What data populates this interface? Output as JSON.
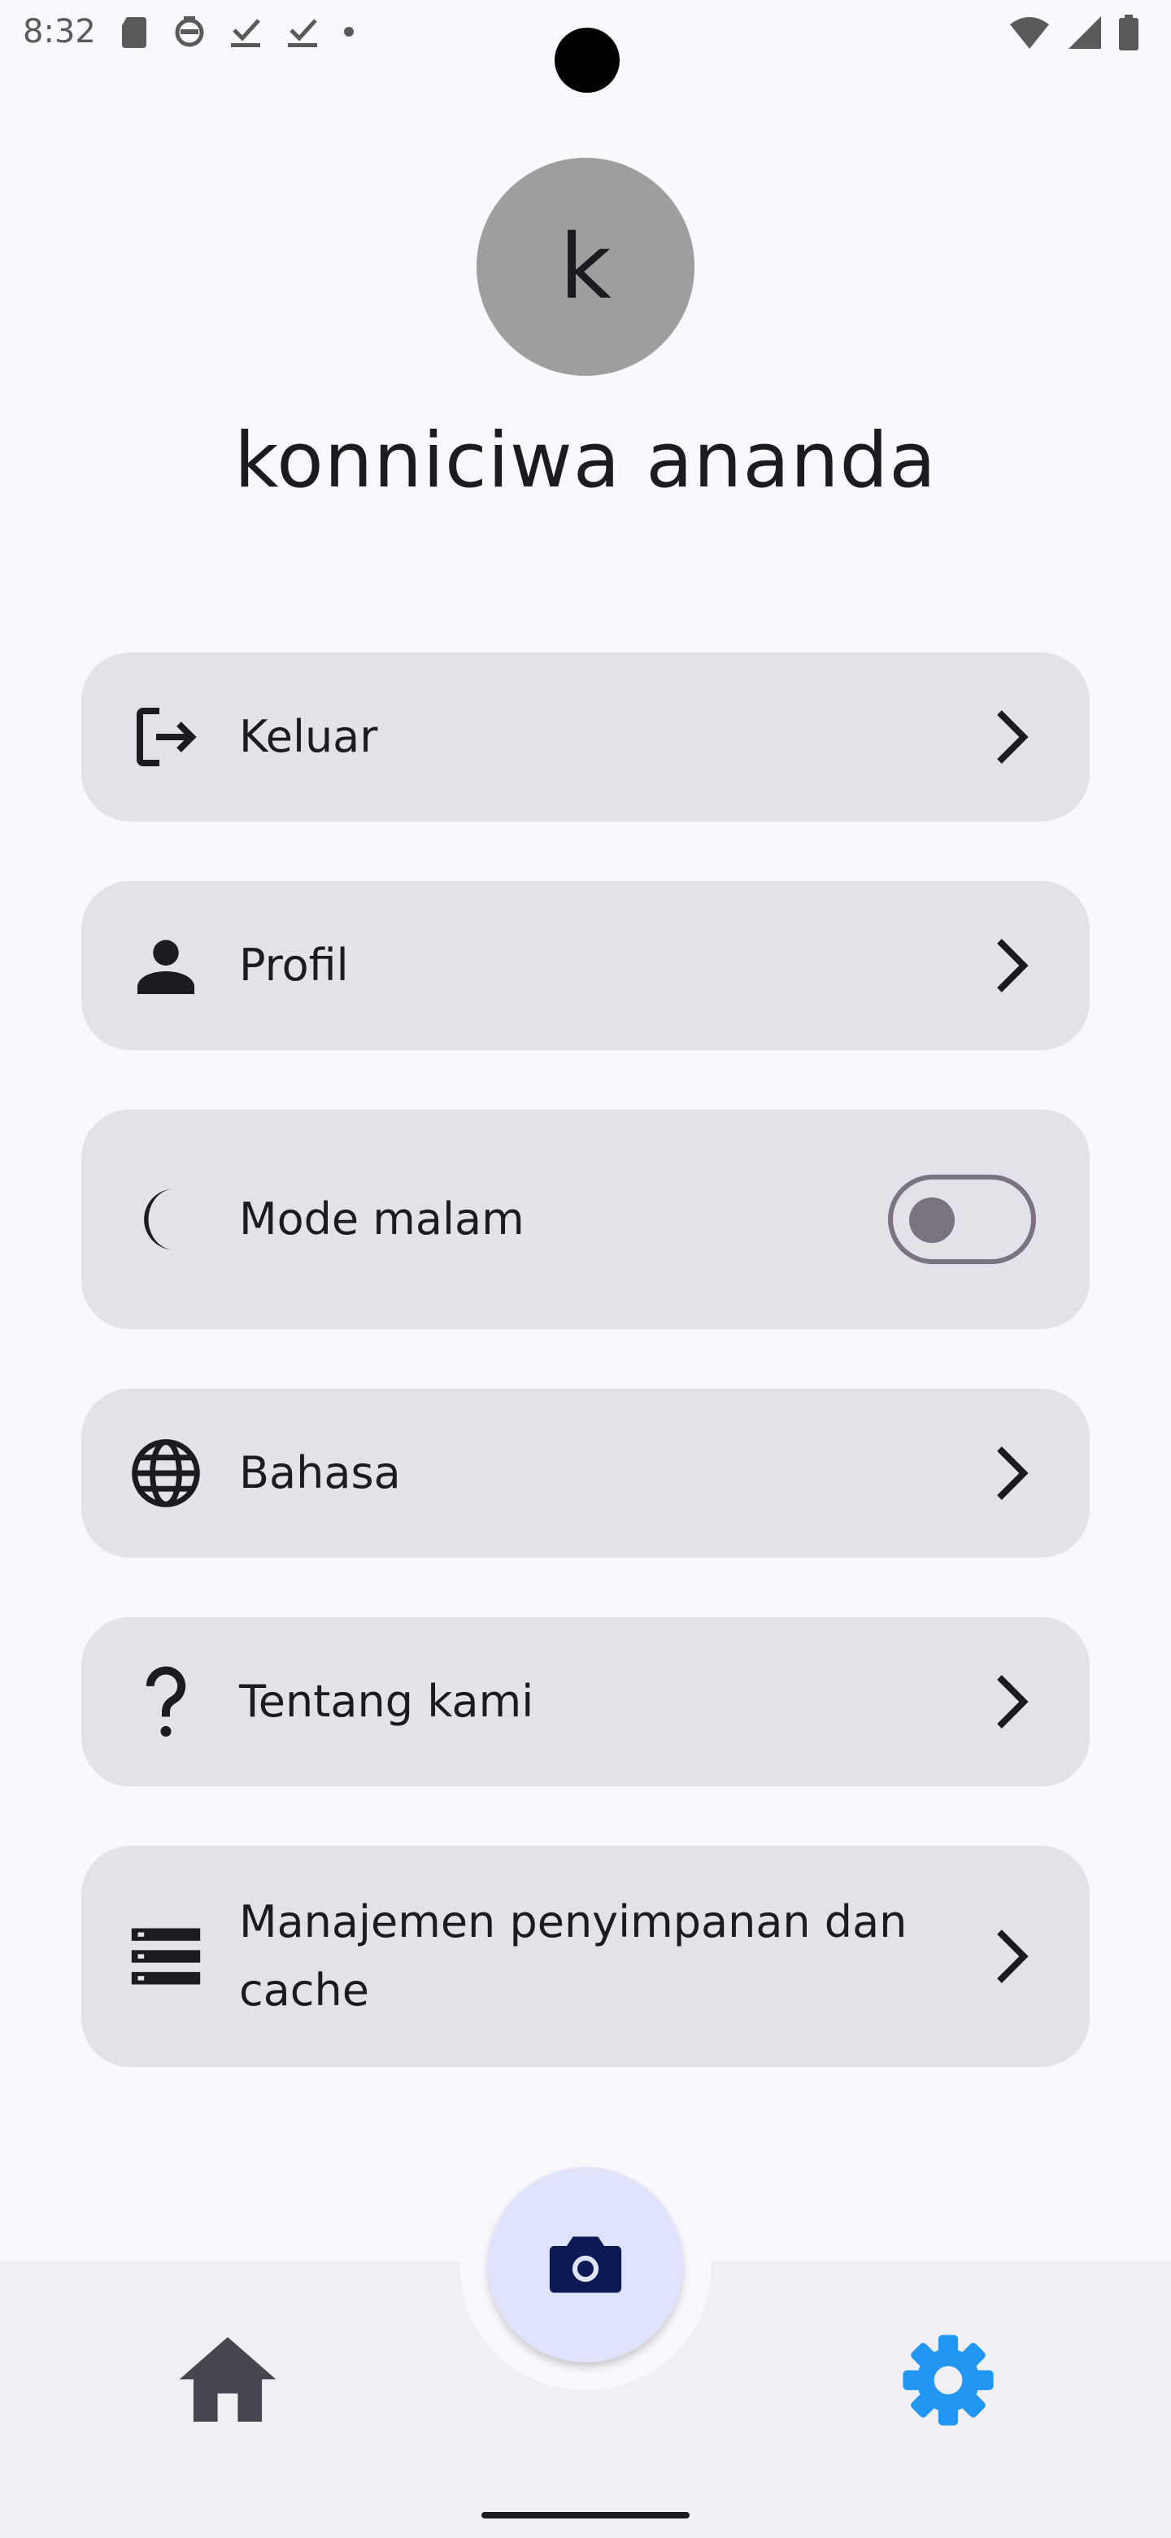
{
  "status_bar": {
    "time": "8:32",
    "left_icons": [
      "sd-card-icon",
      "notification-icon",
      "download-done-icon",
      "download-done-icon",
      "dot-icon"
    ],
    "right_icons": [
      "wifi-icon",
      "signal-icon",
      "battery-icon"
    ]
  },
  "profile": {
    "avatar_letter": "k",
    "name": "konniciwa ananda"
  },
  "menu": {
    "logout": {
      "label": "Keluar",
      "icon": "logout-icon"
    },
    "profile": {
      "label": "Profil",
      "icon": "person-icon"
    },
    "night_mode": {
      "label": "Mode malam",
      "icon": "moon-icon",
      "enabled": false
    },
    "language": {
      "label": "Bahasa",
      "icon": "globe-icon"
    },
    "about": {
      "label": "Tentang kami",
      "icon": "question-icon"
    },
    "storage": {
      "label": "Manajemen penyimpanan dan cache",
      "icon": "storage-icon"
    }
  },
  "bottom_nav": {
    "items": [
      {
        "icon": "home-icon",
        "active": false
      },
      {
        "icon": "camera-icon",
        "active": false
      },
      {
        "icon": "settings-icon",
        "active": true
      }
    ],
    "active_color": "#2196f3",
    "inactive_color": "#49454f"
  }
}
